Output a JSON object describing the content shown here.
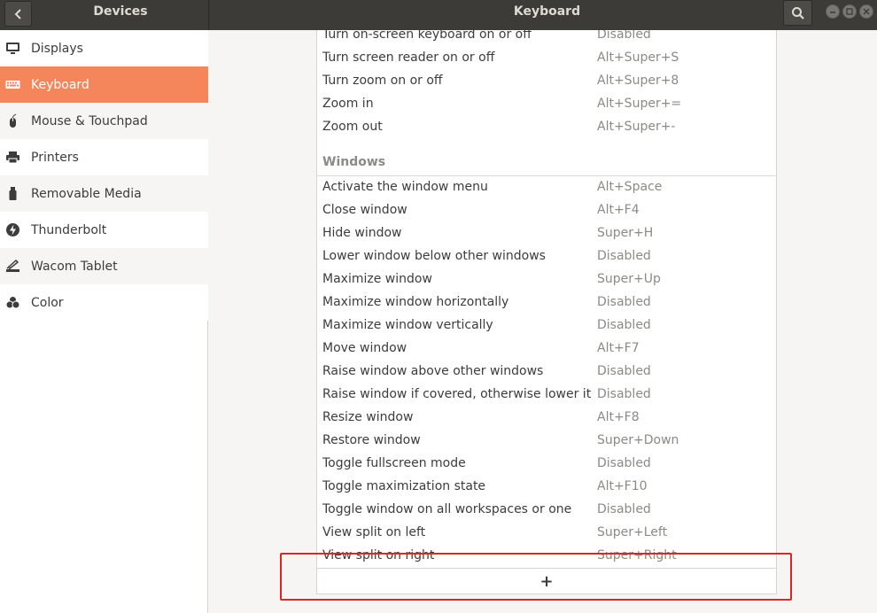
{
  "header": {
    "left_title": "Devices",
    "main_title": "Keyboard"
  },
  "sidebar": {
    "items": [
      {
        "label": "Displays",
        "icon": "display-icon"
      },
      {
        "label": "Keyboard",
        "icon": "keyboard-icon"
      },
      {
        "label": "Mouse & Touchpad",
        "icon": "mouse-icon"
      },
      {
        "label": "Printers",
        "icon": "printer-icon"
      },
      {
        "label": "Removable Media",
        "icon": "usb-icon"
      },
      {
        "label": "Thunderbolt",
        "icon": "thunderbolt-icon"
      },
      {
        "label": "Wacom Tablet",
        "icon": "tablet-icon"
      },
      {
        "label": "Color",
        "icon": "color-icon"
      }
    ],
    "selected": "Keyboard"
  },
  "shortcuts": {
    "accessibility_rows": [
      {
        "name": "Turn on-screen keyboard on or off",
        "accel": "Disabled"
      },
      {
        "name": "Turn screen reader on or off",
        "accel": "Alt+Super+S"
      },
      {
        "name": "Turn zoom on or off",
        "accel": "Alt+Super+8"
      },
      {
        "name": "Zoom in",
        "accel": "Alt+Super+="
      },
      {
        "name": "Zoom out",
        "accel": "Alt+Super+-"
      }
    ],
    "windows_heading": "Windows",
    "windows_rows": [
      {
        "name": "Activate the window menu",
        "accel": "Alt+Space"
      },
      {
        "name": "Close window",
        "accel": "Alt+F4"
      },
      {
        "name": "Hide window",
        "accel": "Super+H"
      },
      {
        "name": "Lower window below other windows",
        "accel": "Disabled"
      },
      {
        "name": "Maximize window",
        "accel": "Super+Up"
      },
      {
        "name": "Maximize window horizontally",
        "accel": "Disabled"
      },
      {
        "name": "Maximize window vertically",
        "accel": "Disabled"
      },
      {
        "name": "Move window",
        "accel": "Alt+F7"
      },
      {
        "name": "Raise window above other windows",
        "accel": "Disabled"
      },
      {
        "name": "Raise window if covered, otherwise lower it",
        "accel": "Disabled"
      },
      {
        "name": "Resize window",
        "accel": "Alt+F8"
      },
      {
        "name": "Restore window",
        "accel": "Super+Down"
      },
      {
        "name": "Toggle fullscreen mode",
        "accel": "Disabled"
      },
      {
        "name": "Toggle maximization state",
        "accel": "Alt+F10"
      },
      {
        "name": "Toggle window on all workspaces or one",
        "accel": "Disabled"
      },
      {
        "name": "View split on left",
        "accel": "Super+Left"
      },
      {
        "name": "View split on right",
        "accel": "Super+Right"
      }
    ],
    "add_label": "+"
  },
  "colors": {
    "header_bg": "#3c3b37",
    "accent": "#f5865b",
    "highlight": "#e02424"
  }
}
